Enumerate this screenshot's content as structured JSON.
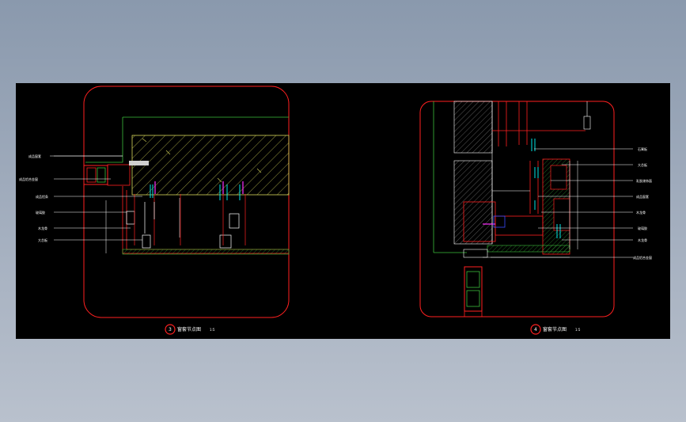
{
  "colors": {
    "background": "#8a99ad",
    "viewport": "#000000",
    "frame": "#ff2020",
    "detail_lines": "#ffffff",
    "outline": "#3cbf3c",
    "hatch": "#d6d65a",
    "cyan": "#00e5e5",
    "magenta": "#ff30ff"
  },
  "drawing1": {
    "number": "3",
    "title": "窗套节点图",
    "scale": "1:5",
    "labels": [
      "成品窗套",
      "成品铝合金窗",
      "成品铝条",
      "玻璃胶",
      "木龙骨",
      "大芯板",
      "石膏板"
    ]
  },
  "drawing2": {
    "number": "4",
    "title": "窗套节点图",
    "scale": "1:5",
    "labels": [
      "石膏板",
      "大芯板",
      "乳胶漆饰面",
      "成品窗套",
      "木龙骨",
      "玻璃胶",
      "木龙骨",
      "成品铝合金窗"
    ]
  }
}
